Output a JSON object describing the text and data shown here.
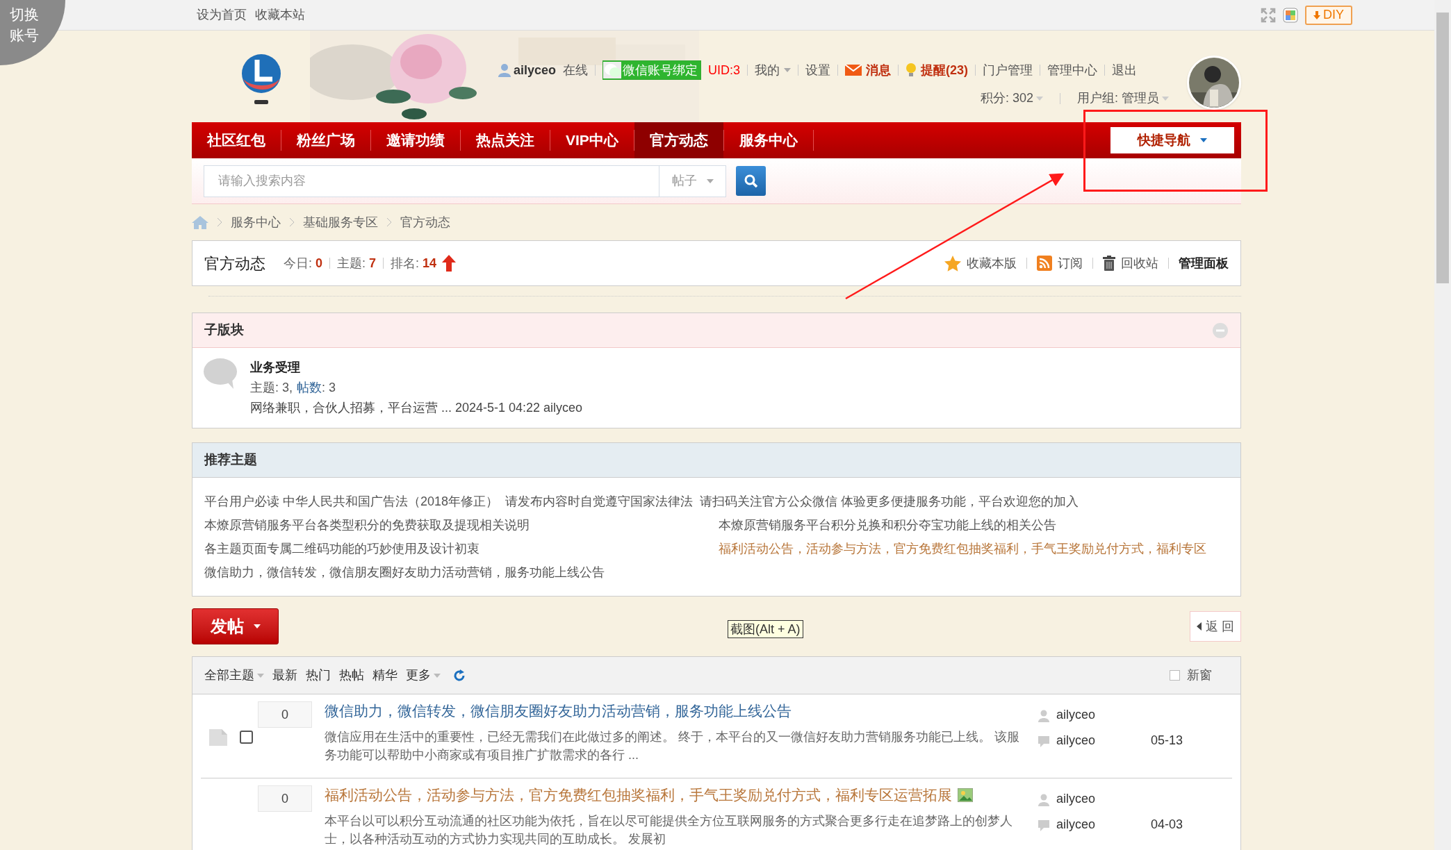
{
  "corner_badge": "切换账号",
  "top_links": [
    "设为首页",
    "收藏本站"
  ],
  "diy_button": "DIY",
  "user_bar": {
    "username": "ailyceo",
    "status": "在线",
    "wechat_button": "微信账号绑定",
    "uid": "UID:3",
    "links": [
      {
        "label": "我的",
        "kind": "dropdown"
      },
      {
        "label": "设置",
        "kind": "link"
      },
      {
        "label": "消息",
        "kind": "mail"
      },
      {
        "label": "提醒(23)",
        "kind": "bulb"
      },
      {
        "label": "门户管理",
        "kind": "link"
      },
      {
        "label": "管理中心",
        "kind": "link"
      },
      {
        "label": "退出",
        "kind": "link"
      }
    ],
    "points": "积分: 302",
    "group": "用户组: 管理员"
  },
  "nav": {
    "items": [
      {
        "label": "社区红包",
        "selected": false
      },
      {
        "label": "粉丝广场",
        "selected": false
      },
      {
        "label": "邀请功绩",
        "selected": false
      },
      {
        "label": "热点关注",
        "selected": false
      },
      {
        "label": "VIP中心",
        "selected": false
      },
      {
        "label": "官方动态",
        "selected": true
      },
      {
        "label": "服务中心",
        "selected": false
      }
    ],
    "quick_nav": "快捷导航"
  },
  "search": {
    "placeholder": "请输入搜索内容",
    "type": "帖子"
  },
  "breadcrumb": [
    "服务中心",
    "基础服务专区",
    "官方动态"
  ],
  "forum_header": {
    "title": "官方动态",
    "stats": [
      {
        "label": "今日:",
        "value": "0"
      },
      {
        "label": "主题:",
        "value": "7"
      },
      {
        "label": "排名:",
        "value": "14"
      }
    ],
    "actions": [
      {
        "label": "收藏本版",
        "kind": "star"
      },
      {
        "label": "订阅",
        "kind": "rss"
      },
      {
        "label": "回收站",
        "kind": "trash"
      },
      {
        "label": "管理面板",
        "kind": "plain"
      }
    ]
  },
  "subforums": {
    "title": "子版块",
    "expanded": true,
    "items": [
      {
        "name": "业务受理",
        "topics": "主题: 3,",
        "posts_link": "帖数",
        "posts_value": ": 3",
        "last_post": "网络兼职，合伙人招募，平台运营 ... 2024-5-1 04:22 ailyceo"
      }
    ]
  },
  "recommended": {
    "title": "推荐主题",
    "rows": [
      [
        {
          "text": "平台用户必读 中华人民共和国广告法（2018年修正）",
          "color": "#555555"
        },
        {
          "text": "请发布内容时自觉遵守国家法律法",
          "color": "#555555"
        },
        {
          "text": "请扫码关注官方公众微信 体验更多便捷服务功能，平台欢迎您的加入",
          "color": "#555555"
        }
      ],
      [
        {
          "text": "本燎原营销服务平台各类型积分的免费获取及提现相关说明",
          "color": "#555555"
        },
        {
          "text": "本燎原营销服务平台积分兑换和积分夺宝功能上线的相关公告",
          "color": "#555555"
        }
      ],
      [
        {
          "text": "各主题页面专属二维码功能的巧妙使用及设计初衷",
          "color": "#555555"
        },
        {
          "text": "福利活动公告，活动参与方法，官方免费红包抽奖福利，手气王奖励兑付方式，福利专区",
          "color": "#b8763a"
        }
      ],
      [
        {
          "text": "微信助力，微信转发，微信朋友圈好友助力活动营销，服务功能上线公告",
          "color": "#555555"
        }
      ]
    ]
  },
  "post_button": "发帖",
  "screenshot_tip": "截图(Alt + A)",
  "back_button": "返 回",
  "thread_toolbar": {
    "filters": [
      {
        "label": "全部主题",
        "dropdown": true
      },
      {
        "label": "最新",
        "dropdown": false
      },
      {
        "label": "热门",
        "dropdown": false
      },
      {
        "label": "热帖",
        "dropdown": false
      },
      {
        "label": "精华",
        "dropdown": false
      },
      {
        "label": "更多",
        "dropdown": true
      }
    ],
    "new_window": {
      "label": "新窗",
      "checked": false
    }
  },
  "threads": [
    {
      "replies": "0",
      "title": "微信助力，微信转发，微信朋友圈好友助力活动营销，服务功能上线公告",
      "color": "#336699",
      "has_image": false,
      "selectable": true,
      "checked": false,
      "excerpt": "微信应用在生活中的重要性，已经无需我们在此做过多的阐述。 终于，本平台的又一微信好友助力营销服务功能已上线。 该服务功能可以帮助中小商家或有项目推广扩散需求的各行 ...",
      "author": "ailyceo",
      "last_poster": "ailyceo",
      "date": "05-13"
    },
    {
      "replies": "0",
      "title": "福利活动公告，活动参与方法，官方免费红包抽奖福利，手气王奖励兑付方式，福利专区运营拓展",
      "color": "#b8763a",
      "has_image": true,
      "selectable": false,
      "excerpt": "本平台以可以积分互动流通的社区功能为依托，旨在以尽可能提供全方位互联网服务的方式聚合更多行走在追梦路上的创梦人士，以各种活动互动的方式协力实现共同的互助成长。 发展初",
      "author": "ailyceo",
      "last_poster": "ailyceo",
      "date": "04-03"
    }
  ]
}
